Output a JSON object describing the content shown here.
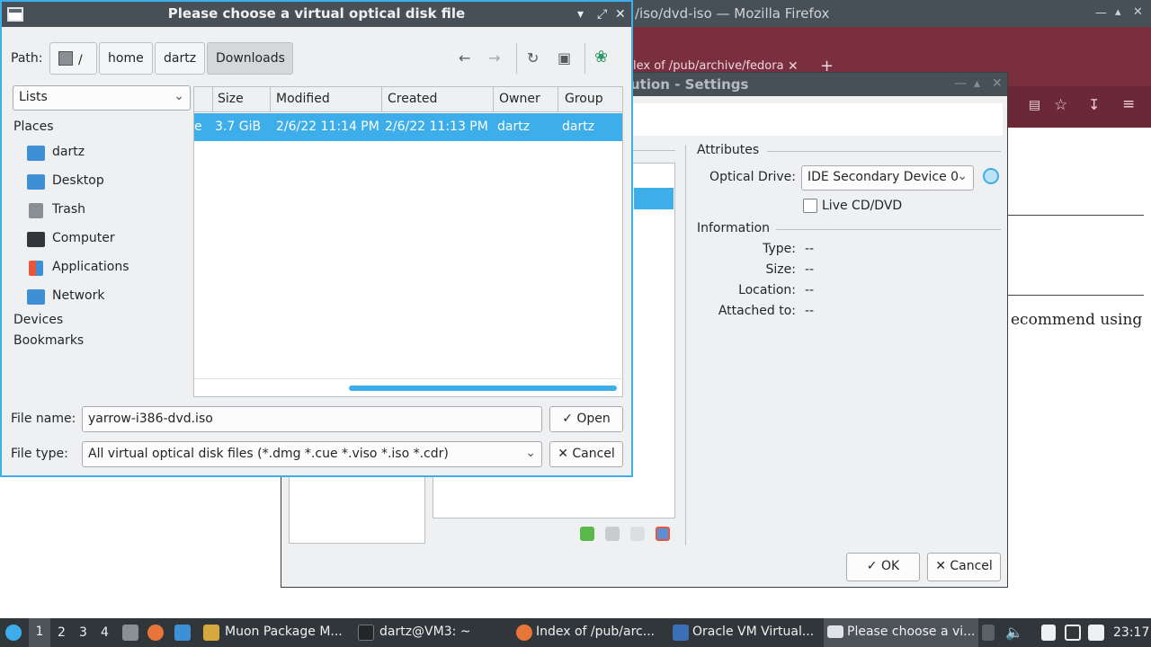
{
  "firefox": {
    "title": "/iso/dvd-iso — Mozilla Firefox",
    "tab_label": "lex of /pub/archive/fedora",
    "page_text": "ecommend using"
  },
  "vbox_settings": {
    "title": "ution - Settings",
    "attributes_heading": "Attributes",
    "optical_drive_label": "Optical Drive:",
    "optical_drive_value": "IDE Secondary Device 0",
    "live_cd_label": "Live CD/DVD",
    "information_heading": "Information",
    "info": [
      {
        "key": "Type:",
        "value": "--"
      },
      {
        "key": "Size:",
        "value": "--"
      },
      {
        "key": "Location:",
        "value": "--"
      },
      {
        "key": "Attached to:",
        "value": "--"
      }
    ],
    "ok_label": "OK",
    "cancel_label": "Cancel"
  },
  "file_dialog": {
    "title": "Please choose a virtual optical disk file",
    "path_label": "Path:",
    "breadcrumbs": [
      "/",
      "home",
      "dartz",
      "Downloads"
    ],
    "lists_label": "Lists",
    "places_heading": "Places",
    "places": [
      {
        "label": "dartz",
        "icon": "home-folder-icon",
        "color": "#3d8fd6"
      },
      {
        "label": "Desktop",
        "icon": "desktop-icon",
        "color": "#3d8fd6"
      },
      {
        "label": "Trash",
        "icon": "trash-icon",
        "color": "#8a8f94"
      },
      {
        "label": "Computer",
        "icon": "computer-icon",
        "color": "#31363b"
      },
      {
        "label": "Applications",
        "icon": "applications-icon",
        "color": "#e8563b"
      },
      {
        "label": "Network",
        "icon": "network-folder-icon",
        "color": "#3d8fd6"
      }
    ],
    "devices_heading": "Devices",
    "bookmarks_heading": "Bookmarks",
    "columns": [
      "Size",
      "Modified",
      "Created",
      "Owner",
      "Group"
    ],
    "row": {
      "name_fragment": "e",
      "size": "3.7 GiB",
      "modified": "2/6/22 11:14 PM",
      "created": "2/6/22 11:13 PM",
      "owner": "dartz",
      "group": "dartz"
    },
    "file_name_label": "File name:",
    "file_name_value": "yarrow-i386-dvd.iso",
    "file_type_label": "File type:",
    "file_type_value": "All virtual optical disk files (*.dmg *.cue *.viso *.iso *.cdr)",
    "open_label": "Open",
    "cancel_label": "Cancel",
    "accent_color": "#3daee9"
  },
  "taskbar": {
    "desktops": [
      "1",
      "2",
      "3",
      "4"
    ],
    "tasks": [
      {
        "label": "Muon Package M..."
      },
      {
        "label": "dartz@VM3: ~"
      },
      {
        "label": "Index of /pub/arc..."
      },
      {
        "label": "Oracle VM Virtual..."
      },
      {
        "label": "Please choose a vi..."
      }
    ],
    "clock": "23:17"
  }
}
